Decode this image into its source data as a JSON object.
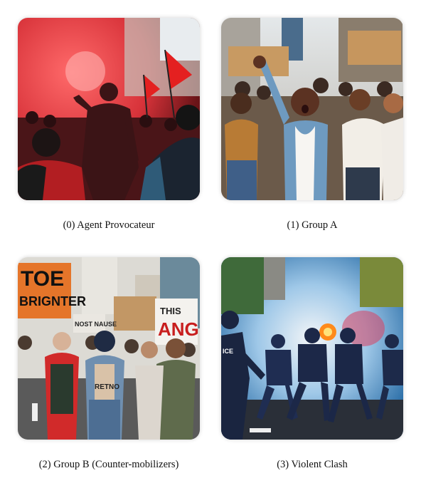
{
  "panels": [
    {
      "caption": "(0) Agent Provocateur"
    },
    {
      "caption": "(1) Group A"
    },
    {
      "caption": "(2) Group B (Counter-mobilizers)"
    },
    {
      "caption": "(3) Violent Clash"
    }
  ],
  "signs": {
    "toe_line1": "TOE",
    "toe_line2": "BRIGNTER",
    "nausea": "NOST NAUSE",
    "angr": "ANG",
    "this": "THIS",
    "ice": "ICE",
    "shirt": "RETNO"
  }
}
